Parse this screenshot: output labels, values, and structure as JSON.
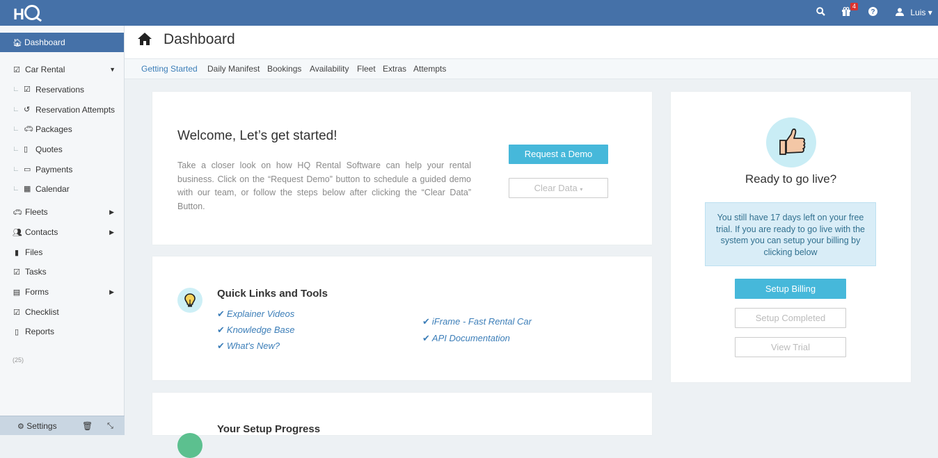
{
  "topbar": {
    "user": "Luis",
    "notification_count": "4"
  },
  "sidebar": {
    "active": "Dashboard",
    "car_rental": "Car Rental",
    "subitems": [
      "Reservations",
      "Reservation Attempts",
      "Packages",
      "Quotes",
      "Payments",
      "Calendar"
    ],
    "items": [
      "Fleets",
      "Contacts",
      "Files",
      "Tasks",
      "Forms",
      "Checklist",
      "Reports"
    ],
    "count": "(25)",
    "settings": "Settings"
  },
  "header": {
    "title": "Dashboard"
  },
  "tabs": [
    "Getting Started",
    "Daily Manifest",
    "Bookings",
    "Availability",
    "Fleet",
    "Extras",
    "Attempts"
  ],
  "welcome": {
    "title": "Welcome, Let’s get started!",
    "text": "Take a closer look on how HQ Rental Software can help your rental business. Click on the “Request Demo” button to schedule a guided demo with our team, or follow the steps below  after clicking the “Clear Data” Button.",
    "request_demo": "Request a Demo",
    "clear_data": "Clear Data"
  },
  "quick_links": {
    "title": "Quick Links and Tools",
    "left": [
      "Explainer Videos",
      "Knowledge Base",
      "What's New?"
    ],
    "right": [
      "iFrame - Fast Rental Car",
      "API Documentation"
    ]
  },
  "setup": {
    "title": "Your Setup Progress"
  },
  "golive": {
    "title": "Ready to go live?",
    "message": "You still have 17 days left on your free trial. If you are ready to go live with the system you can setup your billing by clicking below",
    "setup_billing": "Setup Billing",
    "setup_completed": "Setup Completed",
    "view_trial": "View Trial"
  },
  "colors": {
    "brand": "#4571a8",
    "accent": "#46b8da",
    "link": "#3c7eb8"
  }
}
